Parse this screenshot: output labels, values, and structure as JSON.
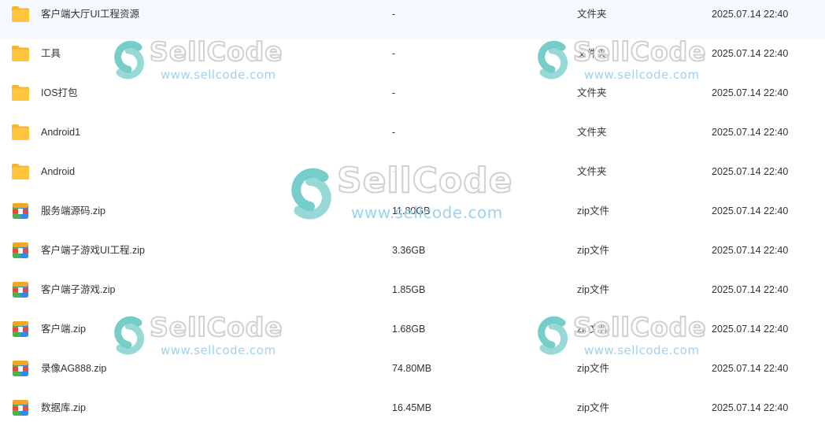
{
  "file_list": {
    "rows": [
      {
        "name": "客户端大厅UI工程资源",
        "size": "-",
        "type": "文件夹",
        "date": "2025.07.14 22:40",
        "icon": "folder-icon"
      },
      {
        "name": "工具",
        "size": "-",
        "type": "文件夹",
        "date": "2025.07.14 22:40",
        "icon": "folder-icon"
      },
      {
        "name": "IOS打包",
        "size": "-",
        "type": "文件夹",
        "date": "2025.07.14 22:40",
        "icon": "folder-icon"
      },
      {
        "name": "Android1",
        "size": "-",
        "type": "文件夹",
        "date": "2025.07.14 22:40",
        "icon": "folder-icon"
      },
      {
        "name": "Android",
        "size": "-",
        "type": "文件夹",
        "date": "2025.07.14 22:40",
        "icon": "folder-icon"
      },
      {
        "name": "服务端源码.zip",
        "size": "11.80GB",
        "type": "zip文件",
        "date": "2025.07.14 22:40",
        "icon": "zip-icon"
      },
      {
        "name": "客户端子游戏UI工程.zip",
        "size": "3.36GB",
        "type": "zip文件",
        "date": "2025.07.14 22:40",
        "icon": "zip-icon"
      },
      {
        "name": "客户端子游戏.zip",
        "size": "1.85GB",
        "type": "zip文件",
        "date": "2025.07.14 22:40",
        "icon": "zip-icon"
      },
      {
        "name": "客户端.zip",
        "size": "1.68GB",
        "type": "zip文件",
        "date": "2025.07.14 22:40",
        "icon": "zip-icon"
      },
      {
        "name": "录像AG888.zip",
        "size": "74.80MB",
        "type": "zip文件",
        "date": "2025.07.14 22:40",
        "icon": "zip-icon"
      },
      {
        "name": "数据库.zip",
        "size": "16.45MB",
        "type": "zip文件",
        "date": "2025.07.14 22:40",
        "icon": "zip-icon"
      }
    ]
  },
  "watermark": {
    "text": "SellCode",
    "url": "www.sellcode.com"
  },
  "colors": {
    "folder": "#ffc53d",
    "folder_back": "#f5b531",
    "zip_left": "#4caf50",
    "zip_right": "#2d8cf0",
    "zip_top": "#f5a623",
    "zip_band": "#e64a3c",
    "watermark_teal": "#5fc4c1",
    "watermark_url": "#9fd2f0"
  }
}
